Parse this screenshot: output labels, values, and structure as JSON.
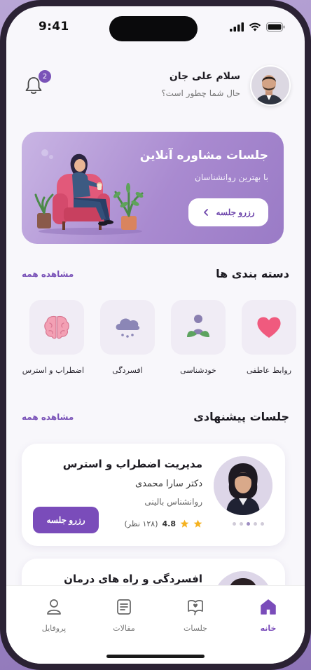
{
  "status_bar": {
    "time": "9:41"
  },
  "header": {
    "greeting": "سلام علی جان",
    "subtitle": "حال شما چطور است؟",
    "notification_count": "2",
    "avatar_icon": "user-avatar-icon"
  },
  "banner": {
    "title": "جلسات مشاوره آنلاین",
    "subtitle": "با بهترین روانشناسان",
    "button_label": "رزرو جلسه"
  },
  "categories_section": {
    "title": "دسته بندی ها",
    "see_all": "مشاهده همه",
    "items": [
      {
        "label": "روابط عاطفی",
        "icon": "heart-icon"
      },
      {
        "label": "خودشناسی",
        "icon": "person-leaves-icon"
      },
      {
        "label": "افسردگی",
        "icon": "rain-cloud-icon"
      },
      {
        "label": "اضطراب و استرس",
        "icon": "brain-icon"
      }
    ]
  },
  "sessions_section": {
    "title": "جلسات پیشنهادی",
    "see_all": "مشاهده همه",
    "cards": [
      {
        "title": "مدیریت اضطراب و استرس",
        "doctor": "دکتر سارا محمدی",
        "role": "روانشناس بالینی",
        "rating": "4.8",
        "reviews": "(۱۲۸ نظر)",
        "button_label": "رزرو جلسه"
      },
      {
        "title": "افسردگی و راه های درمان"
      }
    ]
  },
  "bottom_nav": {
    "items": [
      {
        "label": "خانه",
        "icon": "home-icon",
        "active": true
      },
      {
        "label": "جلسات",
        "icon": "chat-book-icon",
        "active": false
      },
      {
        "label": "مقالات",
        "icon": "article-icon",
        "active": false
      },
      {
        "label": "پروفایل",
        "icon": "profile-icon",
        "active": false
      }
    ]
  },
  "colors": {
    "accent": "#7a4cba",
    "banner": "#a98ad0",
    "background": "#f8f7fb"
  }
}
